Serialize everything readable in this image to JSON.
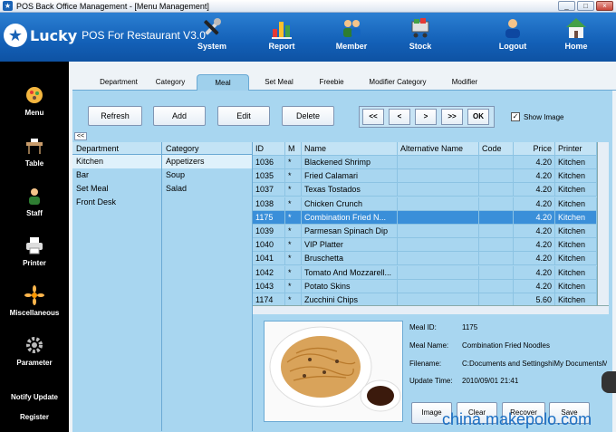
{
  "window": {
    "title": "POS Back Office Management - [Menu Management]",
    "controls": [
      "_",
      "□",
      "×"
    ]
  },
  "header": {
    "brand": "Lucky",
    "subtitle": "POS For Restaurant V3.0",
    "nav": [
      {
        "label": "System",
        "icon": "tools-icon"
      },
      {
        "label": "Report",
        "icon": "bar-chart-icon"
      },
      {
        "label": "Member",
        "icon": "members-icon"
      },
      {
        "label": "Stock",
        "icon": "cart-icon"
      },
      {
        "label": "Logout",
        "icon": "user-logout-icon"
      },
      {
        "label": "Home",
        "icon": "home-icon"
      }
    ]
  },
  "sidebar": {
    "items": [
      {
        "label": "Menu",
        "icon": "menu-icon"
      },
      {
        "label": "Table",
        "icon": "table-icon"
      },
      {
        "label": "Staff",
        "icon": "staff-icon"
      },
      {
        "label": "Printer",
        "icon": "printer-icon"
      },
      {
        "label": "Miscellaneous",
        "icon": "misc-icon"
      },
      {
        "label": "Parameter",
        "icon": "gear-icon"
      }
    ],
    "notify_update": "Notify Update",
    "register": "Register"
  },
  "tabs": [
    "Department",
    "Category",
    "Meal",
    "Set Meal",
    "Freebie",
    "Modifier Category",
    "Modifier"
  ],
  "active_tab": "Meal",
  "toolbar": {
    "refresh": "Refresh",
    "add": "Add",
    "edit": "Edit",
    "delete": "Delete",
    "first": "<<",
    "prev": "<",
    "next": ">",
    "last": ">>",
    "ok": "OK",
    "show_image": "Show Image",
    "show_image_checked": "✓",
    "collapse": "<<"
  },
  "department_list": {
    "header": "Department",
    "items": [
      "Kitchen",
      "Bar",
      "Set Meal",
      "Front Desk"
    ],
    "selected": "Kitchen"
  },
  "category_list": {
    "header": "Category",
    "items": [
      "Appetizers",
      "Soup",
      "Salad"
    ],
    "selected": "Appetizers"
  },
  "meal_table": {
    "columns": [
      "ID",
      "M",
      "Name",
      "Alternative Name",
      "Code",
      "Price",
      "Printer"
    ],
    "rows": [
      [
        "1036",
        "*",
        "Blackened Shrimp",
        "",
        "",
        "4.20",
        "Kitchen"
      ],
      [
        "1035",
        "*",
        "Fried Calamari",
        "",
        "",
        "4.20",
        "Kitchen"
      ],
      [
        "1037",
        "*",
        "Texas Tostados",
        "",
        "",
        "4.20",
        "Kitchen"
      ],
      [
        "1038",
        "*",
        "Chicken Crunch",
        "",
        "",
        "4.20",
        "Kitchen"
      ],
      [
        "1175",
        "*",
        "Combination Fried N...",
        "",
        "",
        "4.20",
        "Kitchen"
      ],
      [
        "1039",
        "*",
        "Parmesan Spinach Dip",
        "",
        "",
        "4.20",
        "Kitchen"
      ],
      [
        "1040",
        "*",
        "VIP Platter",
        "",
        "",
        "4.20",
        "Kitchen"
      ],
      [
        "1041",
        "*",
        "Bruschetta",
        "",
        "",
        "4.20",
        "Kitchen"
      ],
      [
        "1042",
        "*",
        "Tomato And Mozzarell...",
        "",
        "",
        "4.20",
        "Kitchen"
      ],
      [
        "1043",
        "*",
        "Potato Skins",
        "",
        "",
        "4.20",
        "Kitchen"
      ],
      [
        "1174",
        "*",
        "Zucchini Chips",
        "",
        "",
        "5.60",
        "Kitchen"
      ]
    ],
    "selected_row": 4
  },
  "detail": {
    "meal_id_label": "Meal ID:",
    "meal_id": "1175",
    "meal_name_label": "Meal Name:",
    "meal_name": "Combination Fried Noodles",
    "filename_label": "Filename:",
    "filename": "C:Documents and SettingshiMy DocumentsMy",
    "update_time_label": "Update Time:",
    "update_time": "2010/09/01 21:41",
    "buttons": {
      "image": "Image",
      "clear": "Clear",
      "recover": "Recover",
      "save": "Save"
    }
  },
  "watermark": "china.makepolo.com"
}
